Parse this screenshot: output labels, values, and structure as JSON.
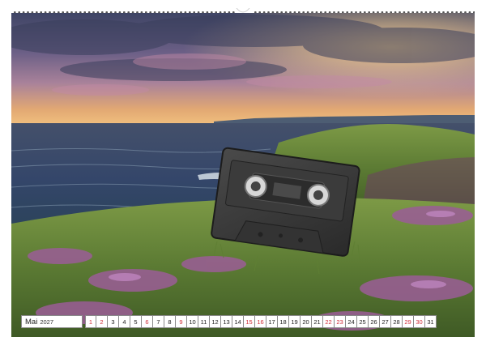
{
  "calendar": {
    "month": "Mai",
    "year": "2027",
    "days": [
      "1",
      "2",
      "3",
      "4",
      "5",
      "6",
      "7",
      "8",
      "9",
      "10",
      "11",
      "12",
      "13",
      "14",
      "15",
      "16",
      "17",
      "18",
      "19",
      "20",
      "21",
      "22",
      "23",
      "24",
      "25",
      "26",
      "27",
      "28",
      "29",
      "30",
      "31"
    ],
    "holidays": [
      "1",
      "2",
      "6",
      "9",
      "15",
      "16",
      "22",
      "23",
      "29",
      "30"
    ]
  },
  "colors": {
    "holiday_text": "#d0303a",
    "regular_text": "#222222"
  },
  "photo": {
    "subject": "cassette-tape",
    "scene": "coastal-heath-at-sunset"
  }
}
